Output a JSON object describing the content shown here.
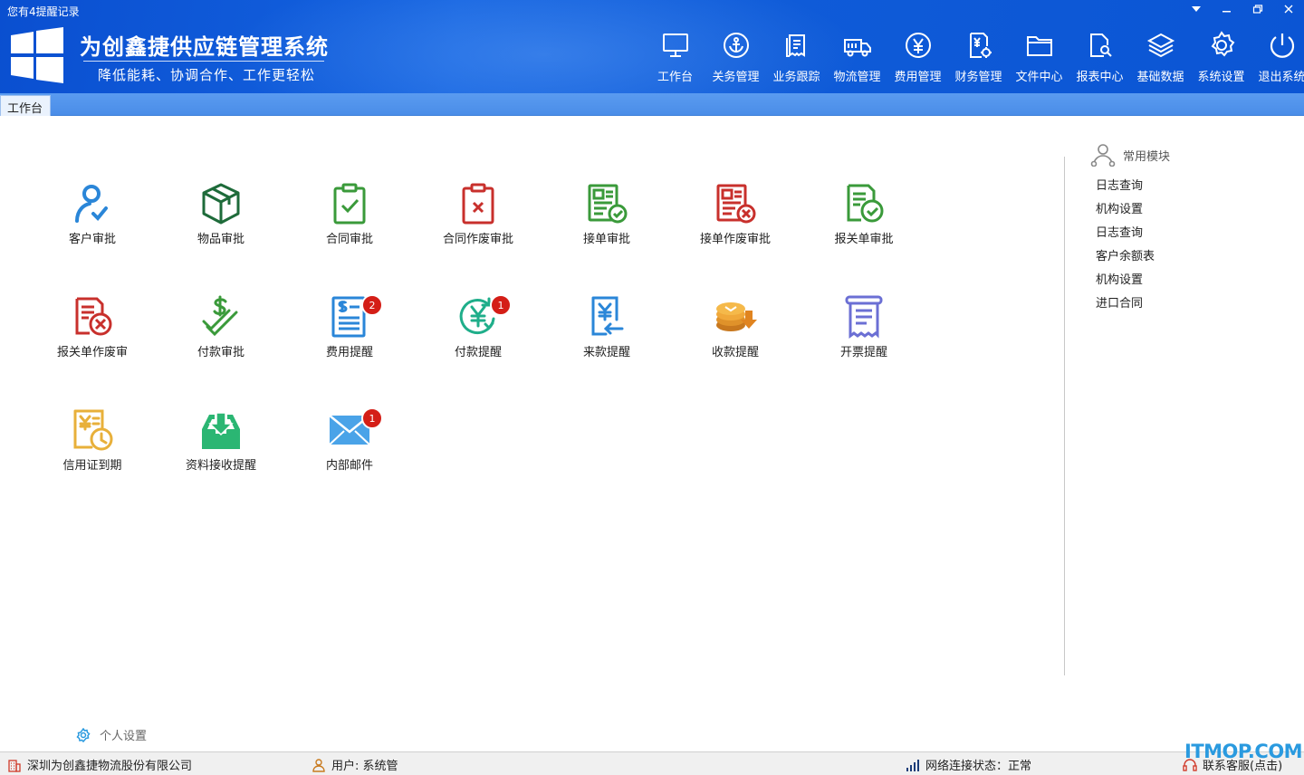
{
  "header": {
    "notice": "您有4提醒记录",
    "title": "为创鑫捷供应链管理系统",
    "slogan": "降低能耗、协调合作、工作更轻松",
    "window_controls": [
      "dropdown-icon",
      "minimize-icon",
      "restore-icon",
      "close-icon"
    ]
  },
  "topnav": [
    {
      "label": "工作台",
      "icon": "monitor-icon"
    },
    {
      "label": "关务管理",
      "icon": "anchor-icon"
    },
    {
      "label": "业务跟踪",
      "icon": "clipboard-icon"
    },
    {
      "label": "物流管理",
      "icon": "truck-icon"
    },
    {
      "label": "费用管理",
      "icon": "yuan-circle-icon"
    },
    {
      "label": "财务管理",
      "icon": "finance-icon"
    },
    {
      "label": "文件中心",
      "icon": "folder-icon"
    },
    {
      "label": "报表中心",
      "icon": "report-search-icon"
    },
    {
      "label": "基础数据",
      "icon": "layers-icon"
    },
    {
      "label": "系统设置",
      "icon": "gear-icon"
    },
    {
      "label": "退出系统",
      "icon": "power-icon"
    }
  ],
  "tabs": [
    {
      "label": "工作台"
    }
  ],
  "modules": [
    {
      "label": "客户审批",
      "icon": "customer-approve-icon"
    },
    {
      "label": "物品审批",
      "icon": "box-icon"
    },
    {
      "label": "合同审批",
      "icon": "clipboard-check-icon"
    },
    {
      "label": "合同作废审批",
      "icon": "clipboard-x-icon"
    },
    {
      "label": "接单审批",
      "icon": "order-check-icon"
    },
    {
      "label": "接单作废审批",
      "icon": "order-x-icon"
    },
    {
      "label": "报关单审批",
      "icon": "declaration-check-icon"
    },
    {
      "label": "报关单作废审",
      "icon": "declaration-x-icon"
    },
    {
      "label": "付款审批",
      "icon": "dollar-check-icon"
    },
    {
      "label": "费用提醒",
      "icon": "bill-icon",
      "badge": "2"
    },
    {
      "label": "付款提醒",
      "icon": "yuan-refresh-icon",
      "badge": "1"
    },
    {
      "label": "来款提醒",
      "icon": "yuan-return-icon"
    },
    {
      "label": "收款提醒",
      "icon": "coins-icon"
    },
    {
      "label": "开票提醒",
      "icon": "receipt-icon"
    },
    {
      "label": "信用证到期",
      "icon": "credit-clock-icon"
    },
    {
      "label": "资料接收提醒",
      "icon": "inbox-download-icon"
    },
    {
      "label": "内部邮件",
      "icon": "mail-icon",
      "badge": "1"
    }
  ],
  "side": {
    "title": "常用模块",
    "items": [
      "日志查询",
      "机构设置",
      "日志查询",
      "客户余额表",
      "机构设置",
      "进口合同"
    ]
  },
  "personal_settings": "个人设置",
  "status": {
    "company": "深圳为创鑫捷物流股份有限公司",
    "user": "用户: 系统管",
    "network": "网络连接状态：正常",
    "support": "联系客服(点击)"
  },
  "watermark": "ITMOP.COM"
}
